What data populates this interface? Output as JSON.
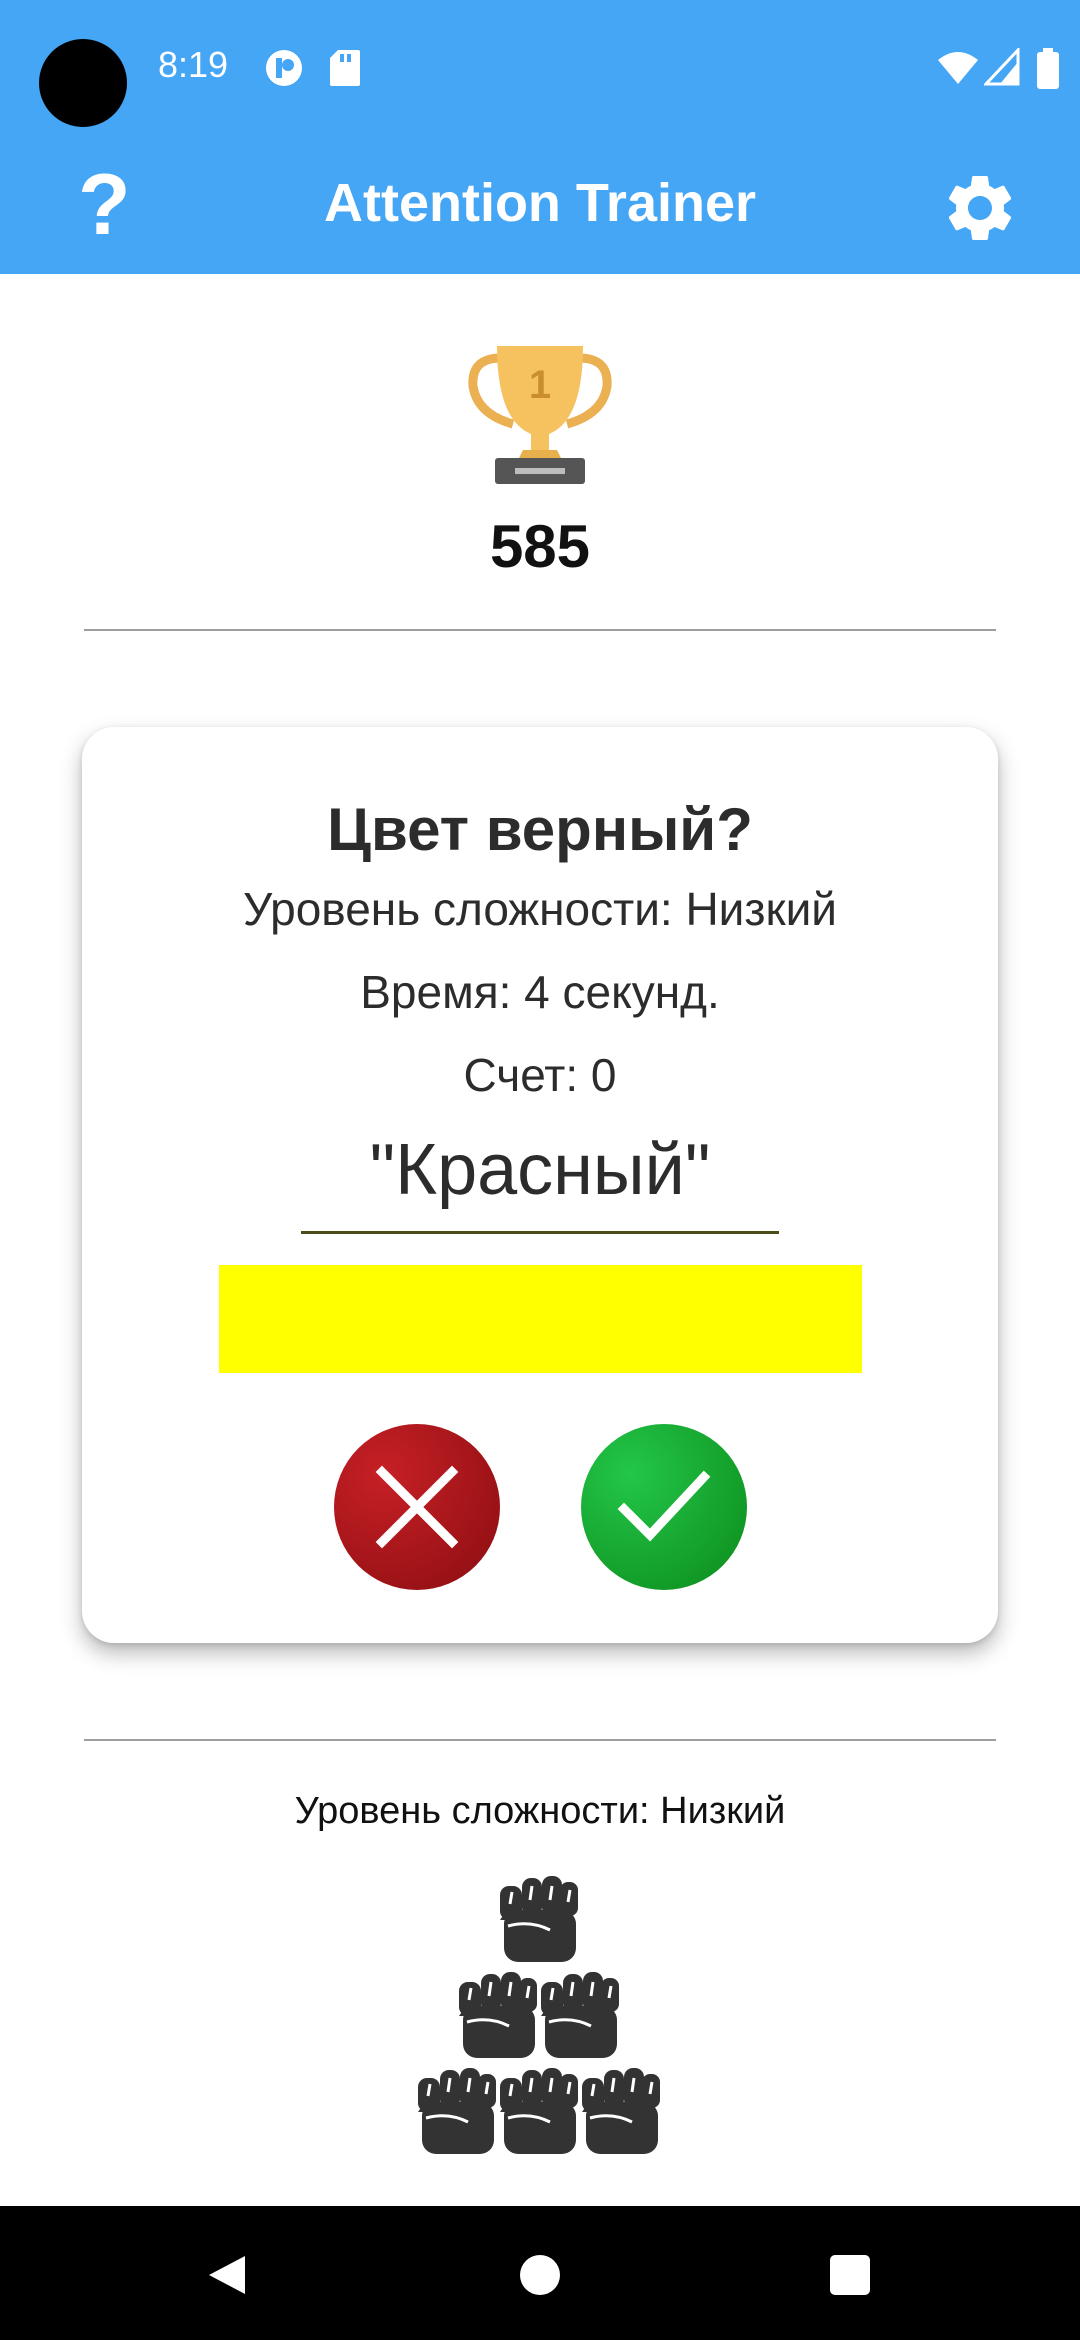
{
  "status_bar": {
    "time": "8:19",
    "left_icons": [
      "camera-cutout",
      "app-notification-icon",
      "sd-card-icon"
    ],
    "right_icons": [
      "wifi-icon",
      "signal-icon",
      "battery-icon"
    ]
  },
  "app_bar": {
    "help_label": "?",
    "title": "Attention Trainer",
    "settings_icon": "gear-icon",
    "color": "#44a6f4"
  },
  "best_score": {
    "icon": "trophy-icon",
    "trophy_rank": "1",
    "value": "585"
  },
  "game_card": {
    "question": "Цвет верный?",
    "difficulty": "Уровень сложности: Низкий",
    "time": "Время: 4 секунд.",
    "score": "Счет: 0",
    "word": "\"Красный\"",
    "swatch_color": "#ffff00",
    "buttons": {
      "wrong": {
        "icon": "close-icon",
        "color": "#b0161b"
      },
      "right": {
        "icon": "check-icon",
        "color": "#1aa834"
      }
    }
  },
  "footer": {
    "difficulty_label": "Уровень сложности: Низкий",
    "fist_icon": "fist-icon",
    "fist_rows": [
      1,
      2,
      3
    ]
  },
  "nav_bar": {
    "buttons": [
      "back-icon",
      "home-icon",
      "recents-icon"
    ]
  }
}
